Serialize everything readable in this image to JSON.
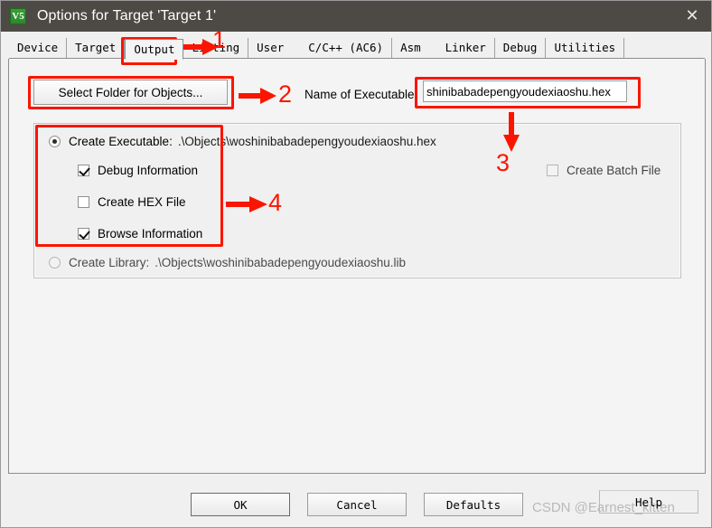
{
  "window": {
    "title": "Options for Target 'Target 1'",
    "icon": "uvision-logo-icon",
    "icon_text": "V5",
    "close_label": "✕"
  },
  "tabs": [
    {
      "label": "Device",
      "selected": false
    },
    {
      "label": "Target",
      "selected": false
    },
    {
      "label": "Output",
      "selected": true
    },
    {
      "label": "Listing",
      "selected": false
    },
    {
      "label": "User",
      "selected": false
    },
    {
      "label": "C/C++ (AC6)",
      "selected": false
    },
    {
      "label": "Asm",
      "selected": false
    },
    {
      "label": "Linker",
      "selected": false
    },
    {
      "label": "Debug",
      "selected": false
    },
    {
      "label": "Utilities",
      "selected": false
    }
  ],
  "output_page": {
    "select_folder_button": "Select Folder for Objects...",
    "name_of_executable_label": "Name of Executable:",
    "name_of_executable_value": "shinibabadepengyoudexiaoshu.hex",
    "name_of_executable_placeholder": "Name of Executable",
    "create_executable": {
      "label": "Create Executable:",
      "path": ".\\Objects\\woshinibabadepengyoudexiaoshu.hex",
      "checked": true
    },
    "create_library": {
      "label": "Create Library:",
      "path": ".\\Objects\\woshinibabadepengyoudexiaoshu.lib",
      "checked": false
    },
    "checkboxes": [
      {
        "label": "Debug Information",
        "checked": true
      },
      {
        "label": "Create HEX File",
        "checked": false
      },
      {
        "label": "Browse Information",
        "checked": true
      },
      {
        "label": "Create Batch File",
        "checked": false
      }
    ]
  },
  "buttons": {
    "ok": "OK",
    "cancel": "Cancel",
    "defaults": "Defaults",
    "help": "Help"
  },
  "annotations": {
    "marker_1": "1",
    "marker_2": "2",
    "marker_3": "3",
    "marker_4": "4",
    "color": "#fb1500"
  },
  "watermark": "CSDN @Earnest_kitten"
}
